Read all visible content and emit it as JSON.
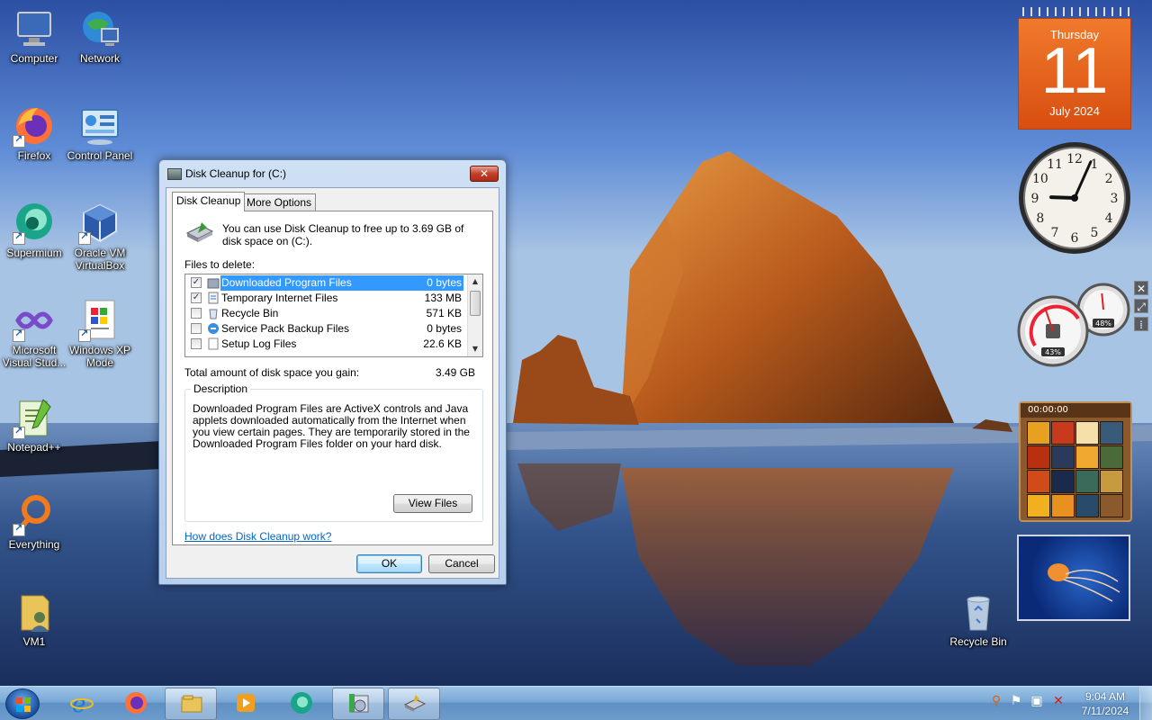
{
  "desktop": {
    "icons": [
      {
        "label": "Computer"
      },
      {
        "label": "Network"
      },
      {
        "label": "Firefox"
      },
      {
        "label": "Control Panel"
      },
      {
        "label": "Supermium"
      },
      {
        "label": "Oracle VM VirtualBox"
      },
      {
        "label": "Microsoft Visual Stud..."
      },
      {
        "label": "Windows XP Mode"
      },
      {
        "label": "Notepad++"
      },
      {
        "label": "Everything"
      },
      {
        "label": "VM1"
      },
      {
        "label": "Recycle Bin"
      }
    ]
  },
  "gadgets": {
    "calendar": {
      "weekday": "Thursday",
      "day": "11",
      "month_year": "July 2024"
    },
    "clock": {
      "hour": 9,
      "minute": 4,
      "numerals": [
        "12",
        "1",
        "2",
        "3",
        "4",
        "5",
        "6",
        "7",
        "8",
        "9",
        "10",
        "11"
      ]
    },
    "meter": {
      "cpu": "43%",
      "memory": "48%",
      "cpu_fraction": 0.43,
      "memory_fraction": 0.48
    },
    "puzzle": {
      "timer": "00:00:00"
    },
    "tools": {
      "close": "✕",
      "resize": "⤢",
      "drag": "⁞"
    }
  },
  "dialog": {
    "title": "Disk Cleanup for  (C:)",
    "close_symbol": "✕",
    "tabs": [
      {
        "label": "Disk Cleanup",
        "active": true
      },
      {
        "label": "More Options",
        "active": false
      }
    ],
    "info_text": "You can use Disk Cleanup to free up to 3.69 GB of disk space on  (C:).",
    "files_label": "Files to delete:",
    "files": [
      {
        "name": "Downloaded Program Files",
        "size": "0 bytes",
        "checked": true,
        "selected": true
      },
      {
        "name": "Temporary Internet Files",
        "size": "133 MB",
        "checked": true,
        "selected": false
      },
      {
        "name": "Recycle Bin",
        "size": "571 KB",
        "checked": false,
        "selected": false
      },
      {
        "name": "Service Pack Backup Files",
        "size": "0 bytes",
        "checked": false,
        "selected": false
      },
      {
        "name": "Setup Log Files",
        "size": "22.6 KB",
        "checked": false,
        "selected": false
      }
    ],
    "total_label": "Total amount of disk space you gain:",
    "total_value": "3.49 GB",
    "description_legend": "Description",
    "description_text": "Downloaded Program Files are ActiveX controls and Java applets downloaded automatically from the Internet when you view certain pages. They are temporarily stored in the Downloaded Program Files folder on your hard disk.",
    "view_files_label": "View Files",
    "help_link": "How does Disk Cleanup work?",
    "ok_label": "OK",
    "cancel_label": "Cancel"
  },
  "taskbar": {
    "pinned": [
      {
        "name": "internet-explorer",
        "open": false
      },
      {
        "name": "firefox",
        "open": false
      },
      {
        "name": "file-explorer",
        "open": true
      },
      {
        "name": "media-player",
        "open": false
      },
      {
        "name": "supermium",
        "open": false
      },
      {
        "name": "program-installer",
        "open": true
      },
      {
        "name": "disk-cleanup",
        "open": true
      }
    ],
    "time": "9:04 AM",
    "date": "7/11/2024"
  }
}
